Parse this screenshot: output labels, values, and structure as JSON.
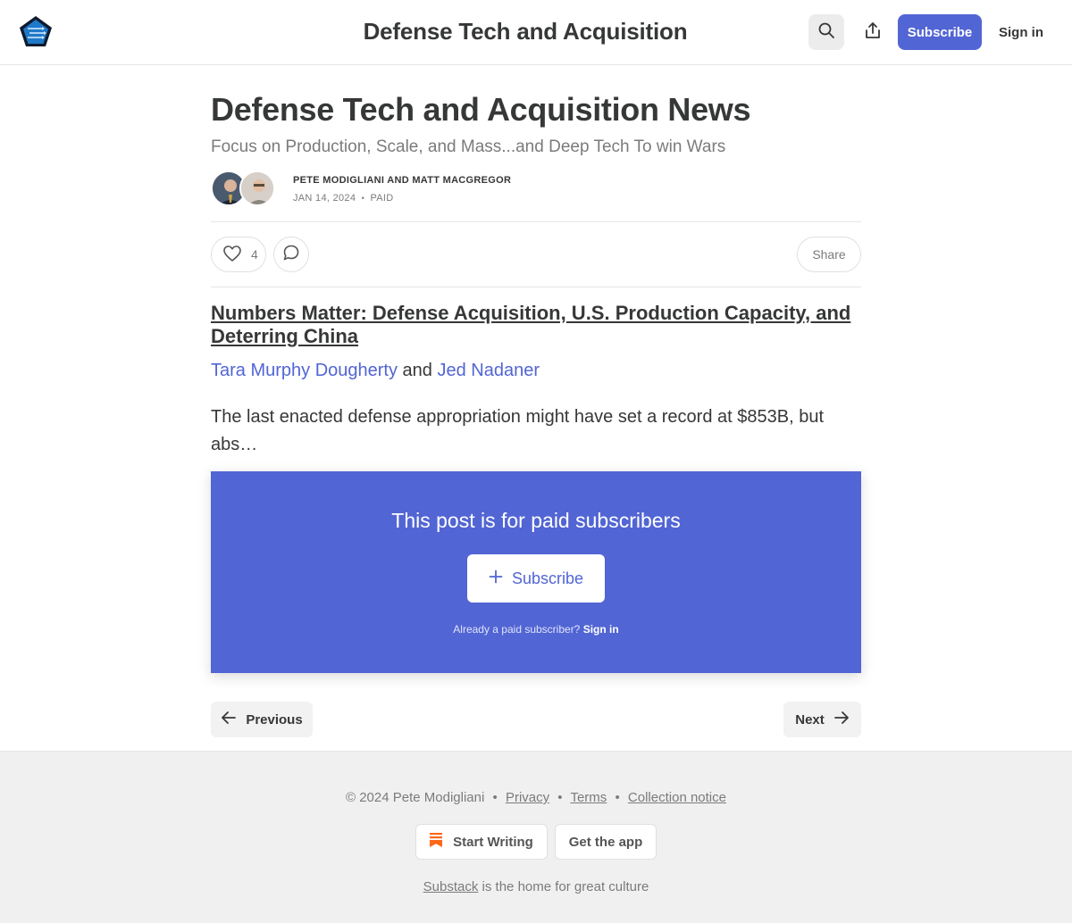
{
  "header": {
    "site_title": "Defense Tech and Acquisition",
    "subscribe_label": "Subscribe",
    "signin_label": "Sign in",
    "accent_color": "#5265d4"
  },
  "post": {
    "title": "Defense Tech and Acquisition News",
    "subtitle": "Focus on Production, Scale, and Mass...and Deep Tech To win Wars",
    "authors": "PETE MODIGLIANI AND MATT MACGREGOR",
    "date": "JAN 14, 2024",
    "meta_separator": "•",
    "access": "PAID",
    "like_count": "4",
    "share_label": "Share"
  },
  "body": {
    "article_link": "Numbers Matter: Defense Acquisition, U.S. Production Capacity, and Deterring China",
    "byline_author_1": "Tara Murphy Dougherty",
    "byline_and": "and",
    "byline_author_2": "Jed Nadaner",
    "excerpt": "The last enacted defense appropriation might have set a record at $853B, but abs…"
  },
  "paywall": {
    "title": "This post is for paid subscribers",
    "subscribe_label": "Subscribe",
    "already_text": "Already a paid subscriber?",
    "signin_label": "Sign in"
  },
  "nav": {
    "previous_label": "Previous",
    "next_label": "Next"
  },
  "footer": {
    "copyright": "© 2024 Pete Modigliani",
    "sep": "•",
    "privacy": "Privacy",
    "terms": "Terms",
    "collection_notice": "Collection notice",
    "start_writing": "Start Writing",
    "get_app": "Get the app",
    "substack_link": "Substack",
    "tagline_rest": "is the home for great culture"
  },
  "icons": {
    "logo": "pentagon-logo-icon",
    "search": "search-icon",
    "share": "share-icon",
    "heart": "heart-icon",
    "comment": "comment-icon",
    "plus": "plus-icon",
    "arrow_left": "arrow-left-icon",
    "arrow_right": "arrow-right-icon",
    "bookmark": "substack-bookmark-icon"
  }
}
